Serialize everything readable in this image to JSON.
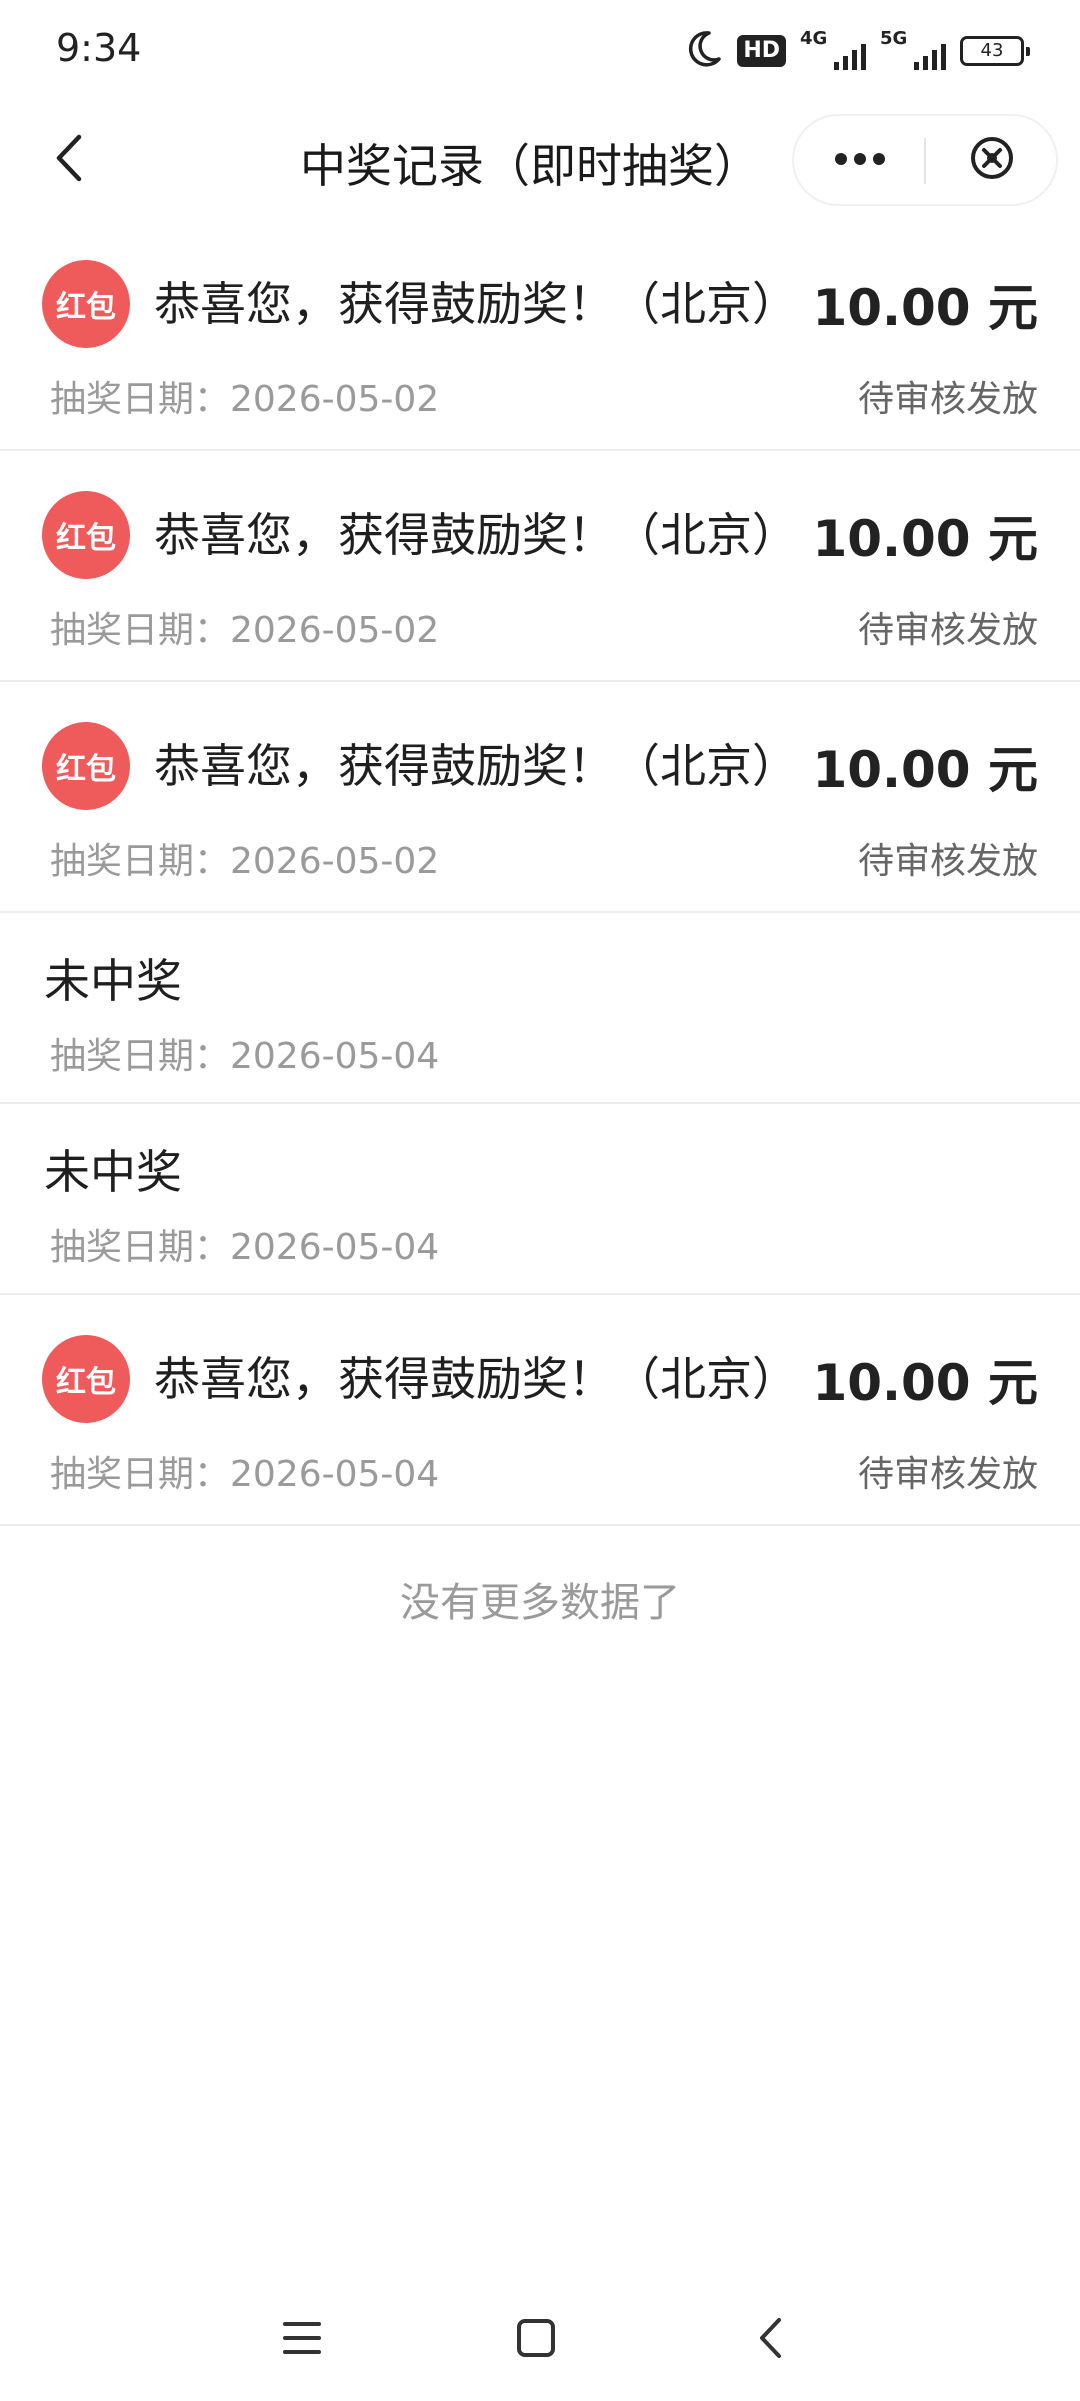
{
  "status_bar": {
    "time": "9:34",
    "hd": "HD",
    "network_1": "4G",
    "network_2": "5G",
    "battery": "43",
    "icons": [
      "moon-icon",
      "hd-icon",
      "signal-4g-icon",
      "signal-5g-icon",
      "battery-icon"
    ]
  },
  "nav": {
    "title": "中奖记录（即时抽奖）",
    "back_icon": "chevron-left-icon",
    "more_icon": "more-dots-icon",
    "close_icon": "close-circle-icon"
  },
  "records": [
    {
      "type": "win",
      "badge": "红包",
      "title": "恭喜您，获得鼓励奖！（北京）",
      "amount": "10.00 元",
      "date": "抽奖日期：2026-05-02",
      "status": "待审核发放"
    },
    {
      "type": "win",
      "badge": "红包",
      "title": "恭喜您，获得鼓励奖！（北京）",
      "amount": "10.00 元",
      "date": "抽奖日期：2026-05-02",
      "status": "待审核发放"
    },
    {
      "type": "win",
      "badge": "红包",
      "title": "恭喜您，获得鼓励奖！（北京）",
      "amount": "10.00 元",
      "date": "抽奖日期：2026-05-02",
      "status": "待审核发放"
    },
    {
      "type": "lose",
      "title": "未中奖",
      "date": "抽奖日期：2026-05-04"
    },
    {
      "type": "lose",
      "title": "未中奖",
      "date": "抽奖日期：2026-05-04"
    },
    {
      "type": "win",
      "badge": "红包",
      "title": "恭喜您，获得鼓励奖！（北京）",
      "amount": "10.00 元",
      "date": "抽奖日期：2026-05-04",
      "status": "待审核发放"
    }
  ],
  "footer": {
    "no_more": "没有更多数据了"
  },
  "system_nav": {
    "icons": [
      "menu-icon",
      "home-icon",
      "back-icon"
    ]
  },
  "colors": {
    "badge_red": "#ef5a5a",
    "text_primary": "#1f1f1f",
    "text_secondary": "#9a9a9a",
    "divider": "#ececec"
  }
}
